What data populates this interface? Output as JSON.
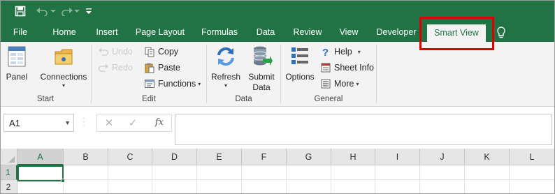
{
  "quick_access": {
    "save_icon": "save-icon",
    "undo_icon": "undo-icon",
    "redo_icon": "redo-icon",
    "customize_icon": "customize-qat-icon"
  },
  "tabs": [
    {
      "label": "File"
    },
    {
      "label": "Home"
    },
    {
      "label": "Insert"
    },
    {
      "label": "Page Layout"
    },
    {
      "label": "Formulas"
    },
    {
      "label": "Data"
    },
    {
      "label": "Review"
    },
    {
      "label": "View"
    },
    {
      "label": "Developer"
    },
    {
      "label": "Smart View",
      "active": true
    }
  ],
  "ribbon": {
    "start": {
      "label": "Start",
      "panel": "Panel",
      "connections": "Connections"
    },
    "edit": {
      "label": "Edit",
      "undo": "Undo",
      "redo": "Redo",
      "copy": "Copy",
      "paste": "Paste",
      "functions": "Functions"
    },
    "data": {
      "label": "Data",
      "refresh": "Refresh",
      "submit_line1": "Submit",
      "submit_line2": "Data"
    },
    "general": {
      "label": "General",
      "options": "Options",
      "help": "Help",
      "sheet_info": "Sheet Info",
      "more": "More"
    }
  },
  "formula_bar": {
    "name_box": "A1",
    "fx_label": "fx",
    "formula": ""
  },
  "grid": {
    "columns": [
      "A",
      "B",
      "C",
      "D",
      "E",
      "F",
      "G",
      "H",
      "I",
      "J",
      "K",
      "L"
    ],
    "rows": [
      "1",
      "2"
    ],
    "selected_cell": "A1"
  },
  "colors": {
    "excel_green": "#217346",
    "highlight_red": "#e00000"
  }
}
